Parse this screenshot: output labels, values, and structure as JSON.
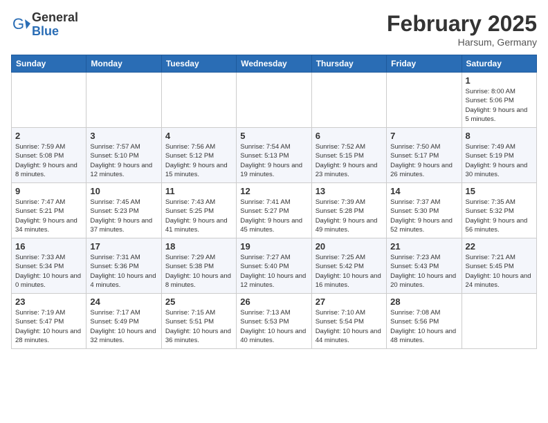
{
  "header": {
    "logo_general": "General",
    "logo_blue": "Blue",
    "month_title": "February 2025",
    "location": "Harsum, Germany"
  },
  "weekdays": [
    "Sunday",
    "Monday",
    "Tuesday",
    "Wednesday",
    "Thursday",
    "Friday",
    "Saturday"
  ],
  "weeks": [
    [
      {
        "day": "",
        "info": ""
      },
      {
        "day": "",
        "info": ""
      },
      {
        "day": "",
        "info": ""
      },
      {
        "day": "",
        "info": ""
      },
      {
        "day": "",
        "info": ""
      },
      {
        "day": "",
        "info": ""
      },
      {
        "day": "1",
        "info": "Sunrise: 8:00 AM\nSunset: 5:06 PM\nDaylight: 9 hours and 5 minutes."
      }
    ],
    [
      {
        "day": "2",
        "info": "Sunrise: 7:59 AM\nSunset: 5:08 PM\nDaylight: 9 hours and 8 minutes."
      },
      {
        "day": "3",
        "info": "Sunrise: 7:57 AM\nSunset: 5:10 PM\nDaylight: 9 hours and 12 minutes."
      },
      {
        "day": "4",
        "info": "Sunrise: 7:56 AM\nSunset: 5:12 PM\nDaylight: 9 hours and 15 minutes."
      },
      {
        "day": "5",
        "info": "Sunrise: 7:54 AM\nSunset: 5:13 PM\nDaylight: 9 hours and 19 minutes."
      },
      {
        "day": "6",
        "info": "Sunrise: 7:52 AM\nSunset: 5:15 PM\nDaylight: 9 hours and 23 minutes."
      },
      {
        "day": "7",
        "info": "Sunrise: 7:50 AM\nSunset: 5:17 PM\nDaylight: 9 hours and 26 minutes."
      },
      {
        "day": "8",
        "info": "Sunrise: 7:49 AM\nSunset: 5:19 PM\nDaylight: 9 hours and 30 minutes."
      }
    ],
    [
      {
        "day": "9",
        "info": "Sunrise: 7:47 AM\nSunset: 5:21 PM\nDaylight: 9 hours and 34 minutes."
      },
      {
        "day": "10",
        "info": "Sunrise: 7:45 AM\nSunset: 5:23 PM\nDaylight: 9 hours and 37 minutes."
      },
      {
        "day": "11",
        "info": "Sunrise: 7:43 AM\nSunset: 5:25 PM\nDaylight: 9 hours and 41 minutes."
      },
      {
        "day": "12",
        "info": "Sunrise: 7:41 AM\nSunset: 5:27 PM\nDaylight: 9 hours and 45 minutes."
      },
      {
        "day": "13",
        "info": "Sunrise: 7:39 AM\nSunset: 5:28 PM\nDaylight: 9 hours and 49 minutes."
      },
      {
        "day": "14",
        "info": "Sunrise: 7:37 AM\nSunset: 5:30 PM\nDaylight: 9 hours and 52 minutes."
      },
      {
        "day": "15",
        "info": "Sunrise: 7:35 AM\nSunset: 5:32 PM\nDaylight: 9 hours and 56 minutes."
      }
    ],
    [
      {
        "day": "16",
        "info": "Sunrise: 7:33 AM\nSunset: 5:34 PM\nDaylight: 10 hours and 0 minutes."
      },
      {
        "day": "17",
        "info": "Sunrise: 7:31 AM\nSunset: 5:36 PM\nDaylight: 10 hours and 4 minutes."
      },
      {
        "day": "18",
        "info": "Sunrise: 7:29 AM\nSunset: 5:38 PM\nDaylight: 10 hours and 8 minutes."
      },
      {
        "day": "19",
        "info": "Sunrise: 7:27 AM\nSunset: 5:40 PM\nDaylight: 10 hours and 12 minutes."
      },
      {
        "day": "20",
        "info": "Sunrise: 7:25 AM\nSunset: 5:42 PM\nDaylight: 10 hours and 16 minutes."
      },
      {
        "day": "21",
        "info": "Sunrise: 7:23 AM\nSunset: 5:43 PM\nDaylight: 10 hours and 20 minutes."
      },
      {
        "day": "22",
        "info": "Sunrise: 7:21 AM\nSunset: 5:45 PM\nDaylight: 10 hours and 24 minutes."
      }
    ],
    [
      {
        "day": "23",
        "info": "Sunrise: 7:19 AM\nSunset: 5:47 PM\nDaylight: 10 hours and 28 minutes."
      },
      {
        "day": "24",
        "info": "Sunrise: 7:17 AM\nSunset: 5:49 PM\nDaylight: 10 hours and 32 minutes."
      },
      {
        "day": "25",
        "info": "Sunrise: 7:15 AM\nSunset: 5:51 PM\nDaylight: 10 hours and 36 minutes."
      },
      {
        "day": "26",
        "info": "Sunrise: 7:13 AM\nSunset: 5:53 PM\nDaylight: 10 hours and 40 minutes."
      },
      {
        "day": "27",
        "info": "Sunrise: 7:10 AM\nSunset: 5:54 PM\nDaylight: 10 hours and 44 minutes."
      },
      {
        "day": "28",
        "info": "Sunrise: 7:08 AM\nSunset: 5:56 PM\nDaylight: 10 hours and 48 minutes."
      },
      {
        "day": "",
        "info": ""
      }
    ]
  ]
}
